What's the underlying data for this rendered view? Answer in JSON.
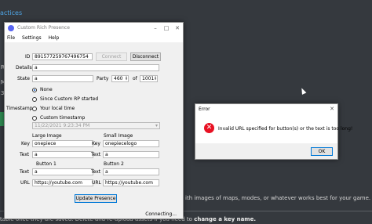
{
  "background": {
    "heading": "actices",
    "side_chars": [
      "R",
      "M",
      "3"
    ],
    "desc_text": "ith images of maps, modes, or whatever works best for your game.",
    "bottom_text": "table once they are saved. Delete and re-upload assets if you need to",
    "bottom_bold": "change a key name."
  },
  "main_window": {
    "title": "Custom Rich Presence",
    "controls": [
      "–",
      "□",
      "✕"
    ],
    "menu": [
      "File",
      "Settings",
      "Help"
    ],
    "id_label": "ID",
    "id_value": "891577259767496754",
    "connect_label": "Connect",
    "disconnect_label": "Disconnect",
    "details_label": "Details",
    "details_value": "a",
    "state_label": "State",
    "state_value": "a",
    "party_label": "Party",
    "party_value": "460",
    "of_label": "of",
    "party_max": "1001",
    "timestamp_label": "Timestamp",
    "timestamp_options": [
      "None",
      "Since Custom RP started",
      "Your local time",
      "Custom timestamp"
    ],
    "timestamp_selected": 0,
    "datetime_value": "11/22/2021   9:23:34 PM",
    "large_image_label": "Large Image",
    "small_image_label": "Small Image",
    "key_label": "Key",
    "text_label": "Text",
    "url_label": "URL",
    "large_key": "onepiece",
    "large_text": "a",
    "small_key": "onepiecelogo",
    "small_text": "a",
    "button1_label": "Button 1",
    "button2_label": "Button 2",
    "button1_text": "a",
    "button1_url": "https://youtube.com",
    "button2_text": "a",
    "button2_url": "https://youtube.com",
    "update_label": "Update Presence",
    "status_text": "Connecting..."
  },
  "error_dialog": {
    "title": "Error",
    "close": "✕",
    "icon": "error-icon",
    "message": "Invalid URL specified for button(s) or the text is too long!",
    "ok_label": "OK"
  },
  "colors": {
    "accent": "#0078d7",
    "error": "#e81123",
    "link": "#4ea5e5",
    "background": "#35393e"
  }
}
